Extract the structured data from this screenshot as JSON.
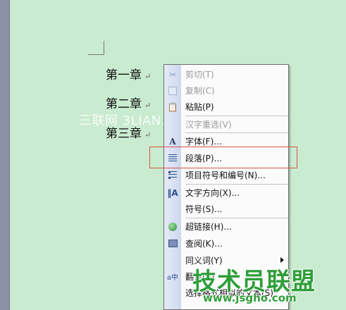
{
  "document": {
    "headings": [
      {
        "text": "第一章",
        "mark": "↵"
      },
      {
        "text": "第二章",
        "mark": "↵"
      },
      {
        "text": "第三章",
        "mark": "↵"
      }
    ],
    "watermark": "三联网 3LIAN.COM"
  },
  "context_menu": {
    "items": [
      {
        "label": "剪切(T)",
        "icon": "scissors-icon",
        "disabled": true
      },
      {
        "label": "复制(C)",
        "icon": "copy-icon",
        "disabled": true
      },
      {
        "label": "粘贴(P)",
        "icon": "paste-icon",
        "disabled": false
      },
      {
        "label": "汉字重选(V)",
        "icon": "",
        "disabled": true
      },
      {
        "label": "字体(F)...",
        "icon": "font-icon",
        "disabled": false
      },
      {
        "label": "段落(P)...",
        "icon": "paragraph-icon",
        "disabled": false,
        "highlighted": true
      },
      {
        "label": "项目符号和编号(N)...",
        "icon": "bullets-icon",
        "disabled": false
      },
      {
        "label": "文字方向(X)...",
        "icon": "text-direction-icon",
        "disabled": false
      },
      {
        "label": "符号(S)...",
        "icon": "",
        "disabled": false
      },
      {
        "label": "超链接(H)...",
        "icon": "hyperlink-icon",
        "disabled": false
      },
      {
        "label": "查阅(K)...",
        "icon": "research-icon",
        "disabled": false
      },
      {
        "label": "同义词(Y)",
        "icon": "",
        "disabled": false,
        "submenu": true
      },
      {
        "label": "翻译(A)",
        "icon": "translate-icon",
        "disabled": false
      },
      {
        "label": "选择格式相似的文本(S)",
        "icon": "",
        "disabled": false
      }
    ]
  },
  "site_watermark": {
    "title": "技术员联盟",
    "url": "www.jsgho.com"
  },
  "colors": {
    "page_bg": "#c9ebcf",
    "menu_bg": "#fbfbfb",
    "highlight_border": "#d9534a",
    "watermark_green": "#2f9e3a"
  }
}
